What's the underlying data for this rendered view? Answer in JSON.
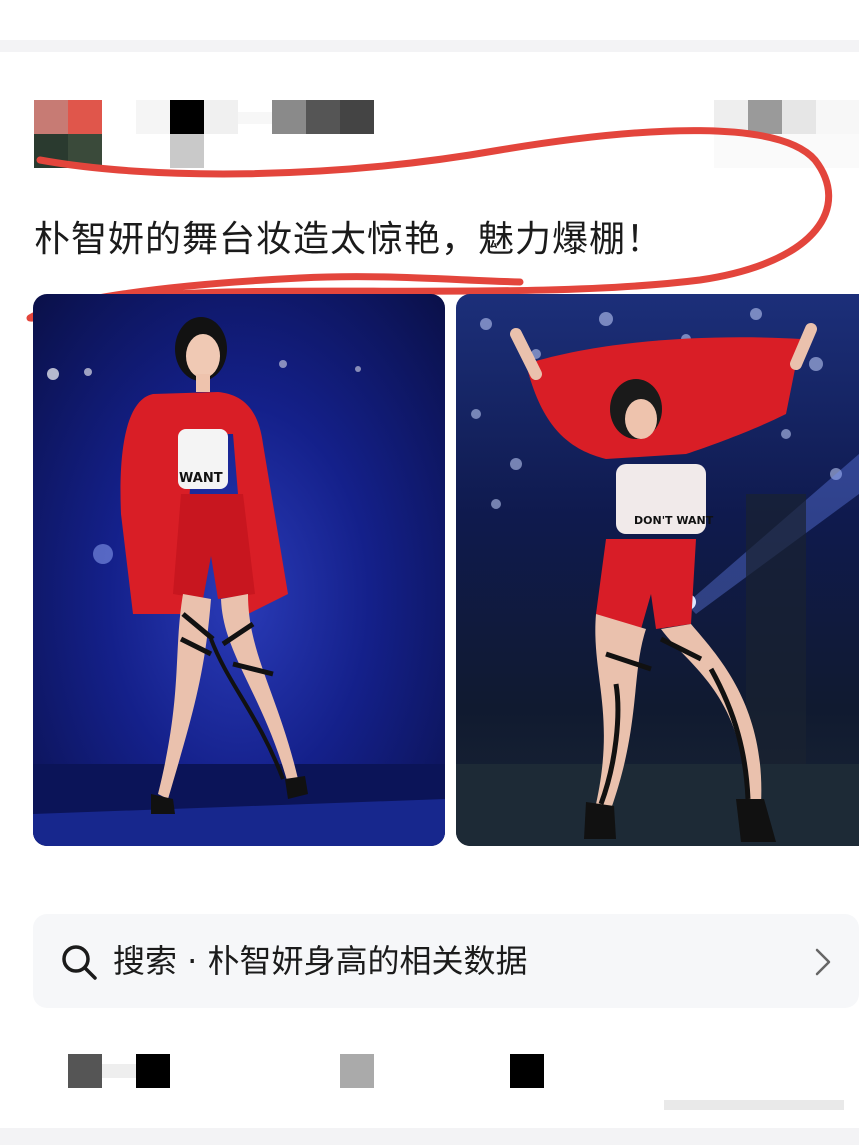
{
  "post": {
    "title": "朴智妍的舞台妆造太惊艳，魅力爆棚！"
  },
  "media": {
    "left_photo_alt": "",
    "right_photo_alt": "",
    "left_shirt_text": "WANT",
    "right_shirt_text": "DON'T WANT"
  },
  "search": {
    "label": "搜索 · 朴智妍身高的相关数据",
    "icon": "search-icon",
    "chevron_icon": "chevron-right-icon"
  },
  "colors": {
    "annotation_red": "#e3453c",
    "outfit_red": "#d91e26",
    "stage_blue": "#14208a",
    "search_bg": "#f6f7f9"
  }
}
